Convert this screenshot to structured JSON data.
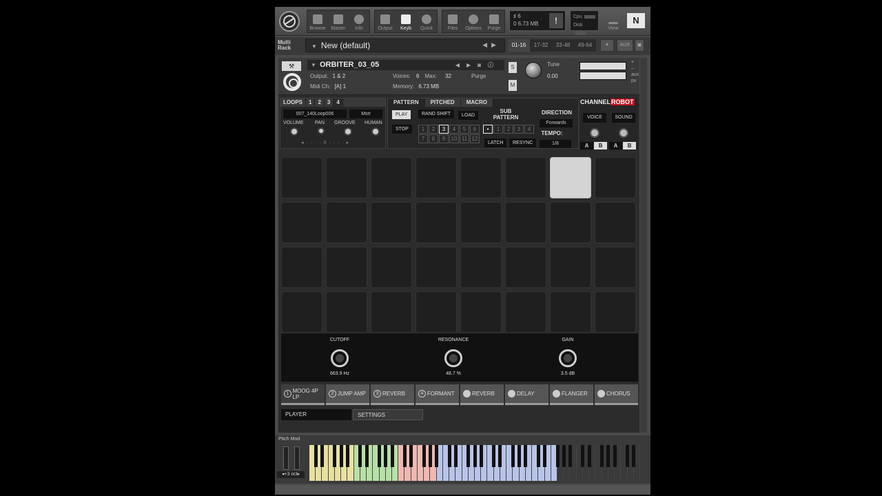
{
  "toolbar": {
    "buttons": [
      {
        "label": "Browse",
        "icon": "folder-icon"
      },
      {
        "label": "Master",
        "icon": "master-icon"
      },
      {
        "label": "Info",
        "icon": "info-icon"
      },
      {
        "label": "Output",
        "icon": "output-icon"
      },
      {
        "label": "Keyb",
        "icon": "keyboard-icon"
      },
      {
        "label": "Quick",
        "icon": "quick-icon"
      },
      {
        "label": "Files",
        "icon": "files-icon"
      },
      {
        "label": "Options",
        "icon": "gear-icon"
      },
      {
        "label": "Purge",
        "icon": "purge-icon"
      }
    ],
    "voices": "♯ 6",
    "memory": "0  6.73 MB",
    "cpu_label": "Cpu",
    "disk_label": "Disk",
    "view_label": "View",
    "ni_logo": "N"
  },
  "rack": {
    "multi_label_1": "Multi",
    "multi_label_2": "Rack",
    "preset": "New (default)",
    "pages": [
      "01-16",
      "17-32",
      "33-48",
      "49-64"
    ],
    "aux": "AUX"
  },
  "instrument": {
    "name": "ORBITER_03_05",
    "output_label": "Output:",
    "output_value": "1 & 2",
    "voices_label": "Voices:",
    "voices_value": "6",
    "max_label": "Max:",
    "max_value": "32",
    "purge": "Purge",
    "midi_label": "Midi Ch:",
    "midi_value": "[A]  1",
    "memory_label": "Memory:",
    "memory_value": "6.73 MB",
    "s_btn": "S",
    "m_btn": "M",
    "tune_label": "Tune",
    "tune_value": "0.00"
  },
  "loops": {
    "tab_label": "LOOPS",
    "tabs": [
      "1",
      "2",
      "3",
      "4"
    ],
    "file": "007_140Loop006",
    "mstr": "Mstr",
    "controls": [
      "VOLUME",
      "PAN",
      "GROOVE",
      "HUMAN"
    ],
    "value": "0"
  },
  "pattern": {
    "tabs": [
      "PATTERN",
      "PITCHED",
      "MACRO"
    ],
    "play": "PLAY",
    "stop": "STOP",
    "rand_shift": "RAND SHIFT",
    "load": "LOAD",
    "numbers": [
      "1",
      "2",
      "3",
      "4",
      "5",
      "6",
      "7",
      "8",
      "9",
      "10",
      "11",
      "12"
    ],
    "selected_number": "3",
    "sub_pattern_label_1": "SUB",
    "sub_pattern_label_2": "PATTERN",
    "sub_numbers": [
      "•",
      "1",
      "2",
      "3",
      "4"
    ],
    "latch": "LATCH",
    "resync": "RESYNC",
    "direction_label": "DIRECTION",
    "direction_value": "Forwards",
    "tempo_label": "TEMPO:",
    "tempo_value": "1/8"
  },
  "channel_robot": {
    "logo_a": "CHANNEL",
    "logo_b": "ROBOT",
    "voice": "VOICE",
    "sound": "SOUND",
    "ab": [
      "A",
      "B",
      "A",
      "B"
    ]
  },
  "pads": {
    "rows": 4,
    "cols": 8,
    "lit_index": 6
  },
  "fx_knobs": [
    {
      "label": "CUTOFF",
      "value": "663.9 Hz"
    },
    {
      "label": "RESONANCE",
      "value": "48.7 %"
    },
    {
      "label": "GAIN",
      "value": "3.5 dB"
    }
  ],
  "fx_slots": [
    {
      "num": "1",
      "label": "MOOG 4P LP",
      "active": true
    },
    {
      "num": "2",
      "label": "JUMP AMP",
      "active": false
    },
    {
      "num": "3",
      "label": "REVERB",
      "active": false
    },
    {
      "num": "4",
      "label": "FORMANT",
      "active": false
    },
    {
      "num": "",
      "label": "REVERB",
      "active": false
    },
    {
      "num": "",
      "label": "DELAY",
      "active": false
    },
    {
      "num": "",
      "label": "FLANGER",
      "active": false
    },
    {
      "num": "",
      "label": "CHORUS",
      "active": false
    }
  ],
  "bottom_tabs": {
    "player": "PLAYER",
    "settings": "SETTINGS"
  },
  "keyboard": {
    "pitch_mod": "Pitch Mod",
    "octave": "+3 oct",
    "key_colors": {
      "yellow": "#e7e0a0",
      "green": "#b7e0a6",
      "pink": "#f0b8b0",
      "blue": "#b8c4e8",
      "dark": "#3a3a3a"
    }
  }
}
